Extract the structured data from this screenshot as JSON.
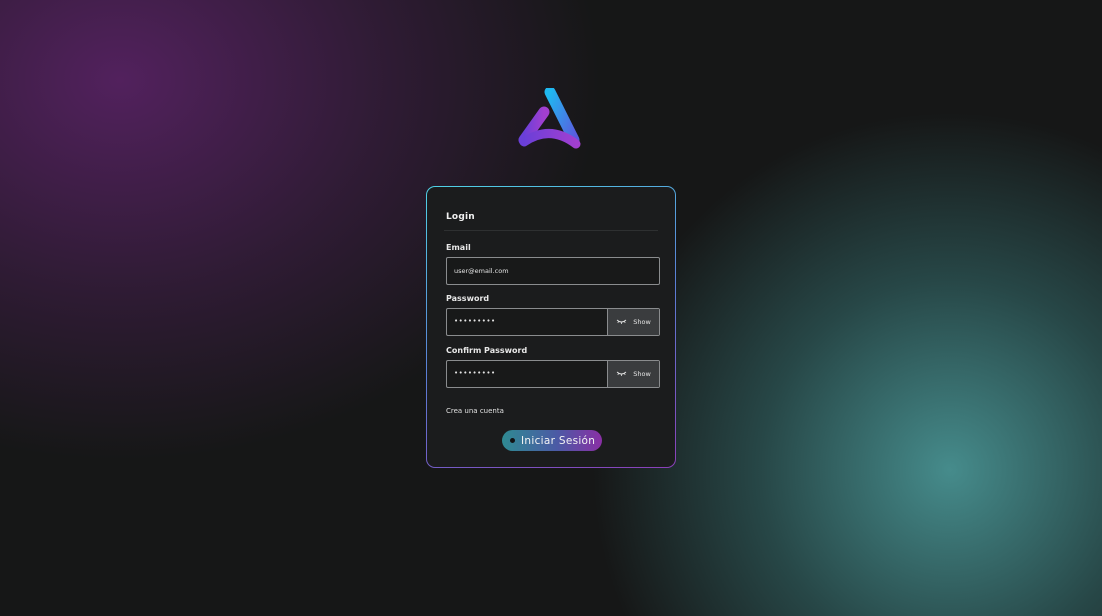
{
  "brand": {
    "logo_icon": "triangle-a-logo-icon",
    "colors": {
      "accent_cyan": "#4fd3e6",
      "accent_purple": "#8b3fb8",
      "background": "#161717"
    }
  },
  "login": {
    "title": "Login",
    "email": {
      "label": "Email",
      "value": "user@email.com"
    },
    "password": {
      "label": "Password",
      "value": "•••••••••",
      "toggle_label": "Show",
      "toggle_icon": "eye-closed-icon"
    },
    "confirm_password": {
      "label": "Confirm Password",
      "value": "•••••••••",
      "toggle_label": "Show",
      "toggle_icon": "eye-closed-icon"
    },
    "create_account_link": "Crea una cuenta",
    "submit_label": "Iniciar Sesión"
  }
}
